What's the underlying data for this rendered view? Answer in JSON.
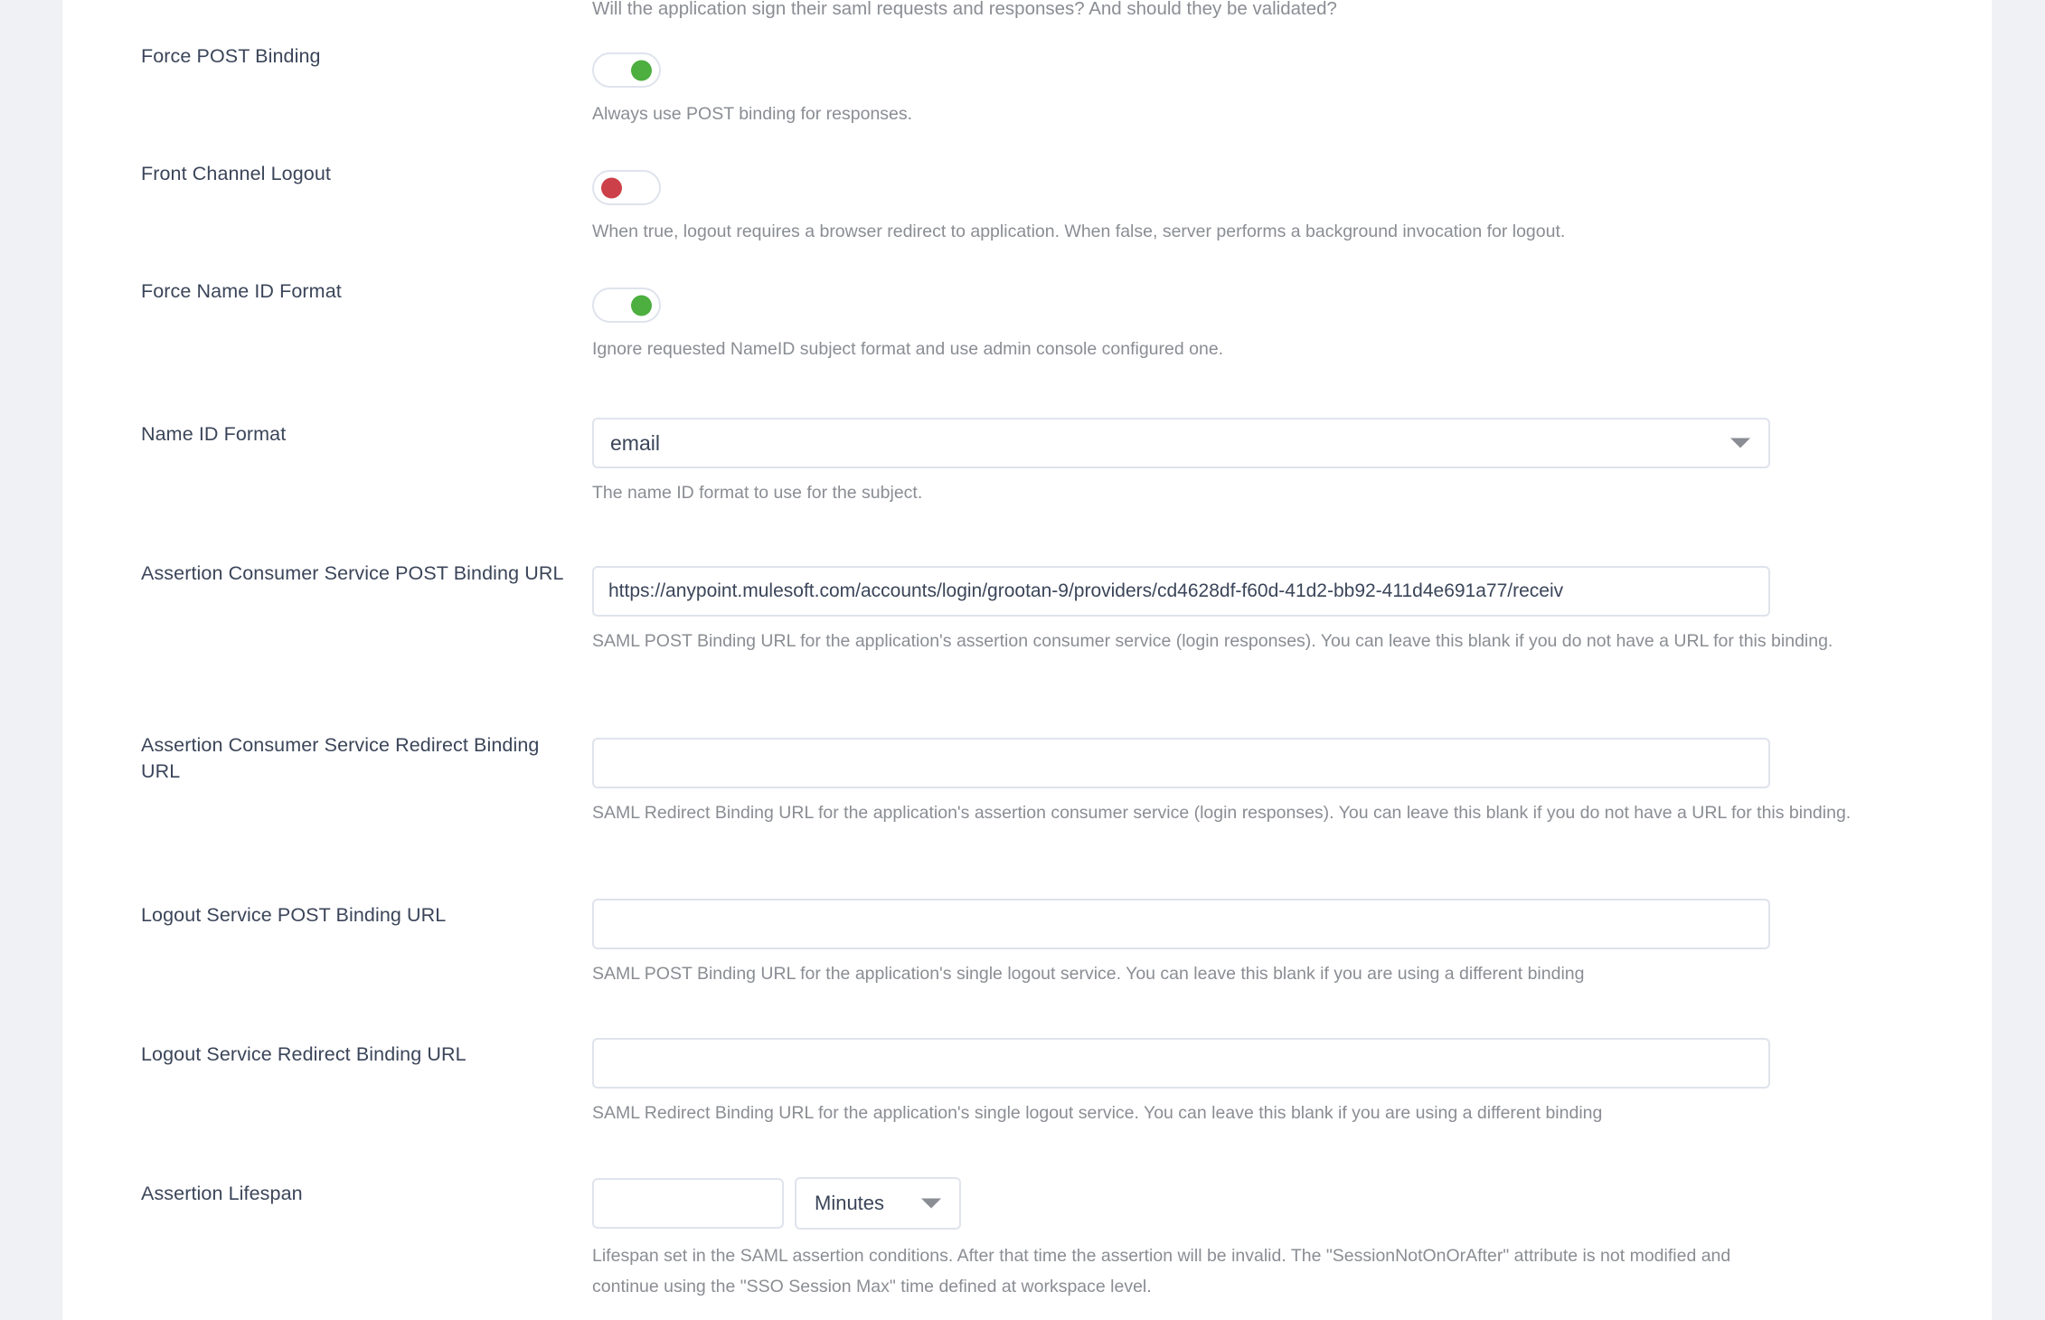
{
  "intro_note": "Will the application sign their saml requests and responses? And should they be validated?",
  "fields": {
    "force_post_binding": {
      "label": "Force POST Binding",
      "state": "on",
      "help": "Always use POST binding for responses."
    },
    "front_channel_logout": {
      "label": "Front Channel Logout",
      "state": "off",
      "help": "When true, logout requires a browser redirect to application. When false, server performs a background invocation for logout."
    },
    "force_name_id_format": {
      "label": "Force Name ID Format",
      "state": "on",
      "help": "Ignore requested NameID subject format and use admin console configured one."
    },
    "name_id_format": {
      "label": "Name ID Format",
      "value": "email",
      "help": "The name ID format to use for the subject."
    },
    "acs_post_binding_url": {
      "label": "Assertion Consumer Service POST Binding URL",
      "value": "https://anypoint.mulesoft.com/accounts/login/grootan-9/providers/cd4628df-f60d-41d2-bb92-411d4e691a77/receiv",
      "help": "SAML POST Binding URL for the application's assertion consumer service (login responses). You can leave this blank if you do not have a URL for this binding."
    },
    "acs_redirect_binding_url": {
      "label": "Assertion Consumer Service Redirect Binding URL",
      "value": "",
      "help": "SAML Redirect Binding URL for the application's assertion consumer service (login responses). You can leave this blank if you do not have a URL for this binding."
    },
    "logout_post_binding_url": {
      "label": "Logout Service POST Binding URL",
      "value": "",
      "help": "SAML POST Binding URL for the application's single logout service. You can leave this blank if you are using a different binding"
    },
    "logout_redirect_binding_url": {
      "label": "Logout Service Redirect Binding URL",
      "value": "",
      "help": "SAML Redirect Binding URL for the application's single logout service. You can leave this blank if you are using a different binding"
    },
    "assertion_lifespan": {
      "label": "Assertion Lifespan",
      "value": "",
      "unit": "Minutes",
      "help": "Lifespan set in the SAML assertion conditions. After that time the assertion will be invalid. The \"SessionNotOnOrAfter\" attribute is not modified and continue using the \"SSO Session Max\" time defined at workspace level."
    }
  },
  "colors": {
    "toggle_on": "#4caf3f",
    "toggle_off": "#cc4049",
    "border": "#dfe3ec",
    "label_text": "#3b4559",
    "help_text": "#8a8d93",
    "page_bg": "#f0f1f5"
  }
}
